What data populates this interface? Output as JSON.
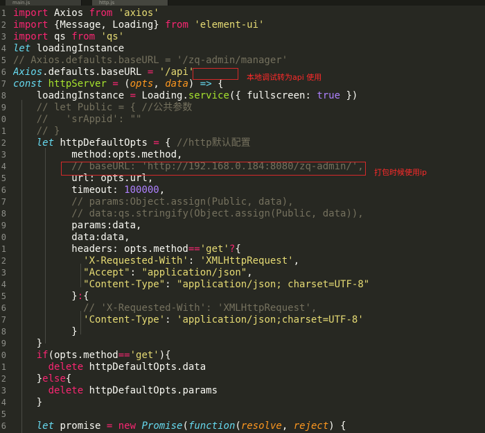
{
  "tabs": [
    "main.js",
    "http.js"
  ],
  "lines": [
    {
      "n": "1",
      "t": [
        [
          "k",
          "import"
        ],
        [
          "pl",
          " Axios "
        ],
        [
          "k",
          "from"
        ],
        [
          "pl",
          " "
        ],
        [
          "s",
          "'axios'"
        ]
      ]
    },
    {
      "n": "2",
      "t": [
        [
          "k",
          "import"
        ],
        [
          "pl",
          " {Message, Loading} "
        ],
        [
          "k",
          "from"
        ],
        [
          "pl",
          " "
        ],
        [
          "s",
          "'element-ui'"
        ]
      ]
    },
    {
      "n": "3",
      "t": [
        [
          "k",
          "import"
        ],
        [
          "pl",
          " qs "
        ],
        [
          "k",
          "from"
        ],
        [
          "pl",
          " "
        ],
        [
          "s",
          "'qs'"
        ]
      ]
    },
    {
      "n": "4",
      "t": [
        [
          "st",
          "let"
        ],
        [
          "pl",
          " loadingInstance"
        ]
      ]
    },
    {
      "n": "5",
      "t": [
        [
          "c",
          "// Axios.defaults.baseURL = '/zq-admin/manager'"
        ]
      ]
    },
    {
      "n": "6",
      "t": [
        [
          "sup",
          "Axios"
        ],
        [
          "pl",
          ".defaults.baseURL "
        ],
        [
          "o",
          "="
        ],
        [
          "pl",
          " "
        ],
        [
          "s",
          "'/api'"
        ]
      ]
    },
    {
      "n": "7",
      "t": [
        [
          "st",
          "const"
        ],
        [
          "pl",
          " "
        ],
        [
          "f",
          "httpServer"
        ],
        [
          "pl",
          " "
        ],
        [
          "o",
          "="
        ],
        [
          "pl",
          " ("
        ],
        [
          "p",
          "opts"
        ],
        [
          "pl",
          ", "
        ],
        [
          "p",
          "data"
        ],
        [
          "pl",
          ") "
        ],
        [
          "st",
          "=>"
        ],
        [
          "pl",
          " {"
        ]
      ]
    },
    {
      "n": "8",
      "t": [
        [
          "pl",
          "    loadingInstance "
        ],
        [
          "o",
          "="
        ],
        [
          "pl",
          " Loading."
        ],
        [
          "f",
          "service"
        ],
        [
          "pl",
          "({ fullscreen: "
        ],
        [
          "n",
          "true"
        ],
        [
          "pl",
          " })"
        ]
      ]
    },
    {
      "n": "9",
      "t": [
        [
          "pl",
          "    "
        ],
        [
          "c",
          "// let Public = { //公共参数"
        ]
      ]
    },
    {
      "n": "0",
      "t": [
        [
          "pl",
          "    "
        ],
        [
          "c",
          "//   'srAppid': \"\""
        ]
      ]
    },
    {
      "n": "1",
      "t": [
        [
          "pl",
          "    "
        ],
        [
          "c",
          "// }"
        ]
      ]
    },
    {
      "n": "2",
      "t": [
        [
          "pl",
          "    "
        ],
        [
          "st",
          "let"
        ],
        [
          "pl",
          " httpDefaultOpts "
        ],
        [
          "o",
          "="
        ],
        [
          "pl",
          " { "
        ],
        [
          "c",
          "//http默认配置"
        ]
      ]
    },
    {
      "n": "3",
      "t": [
        [
          "pl",
          "          method:opts.method,"
        ]
      ]
    },
    {
      "n": "4",
      "t": [
        [
          "pl",
          "          "
        ],
        [
          "c",
          "// baseURL: 'http://192.168.0.184:8080/zq-admin/',"
        ]
      ]
    },
    {
      "n": "5",
      "t": [
        [
          "pl",
          "          url: opts.url,"
        ]
      ]
    },
    {
      "n": "6",
      "t": [
        [
          "pl",
          "          timeout: "
        ],
        [
          "n",
          "100000"
        ],
        [
          "pl",
          ","
        ]
      ]
    },
    {
      "n": "7",
      "t": [
        [
          "pl",
          "          "
        ],
        [
          "c",
          "// params:Object.assign(Public, data),"
        ]
      ]
    },
    {
      "n": "8",
      "t": [
        [
          "pl",
          "          "
        ],
        [
          "c",
          "// data:qs.stringify(Object.assign(Public, data)),"
        ]
      ]
    },
    {
      "n": "9",
      "t": [
        [
          "pl",
          "          params:data,"
        ]
      ]
    },
    {
      "n": "0",
      "t": [
        [
          "pl",
          "          data:data,"
        ]
      ]
    },
    {
      "n": "1",
      "t": [
        [
          "pl",
          "          headers: opts.method"
        ],
        [
          "o",
          "=="
        ],
        [
          "s",
          "'get'"
        ],
        [
          "o",
          "?"
        ],
        [
          "pl",
          "{"
        ]
      ]
    },
    {
      "n": "2",
      "t": [
        [
          "pl",
          "            "
        ],
        [
          "s",
          "'X-Requested-With'"
        ],
        [
          "pl",
          ": "
        ],
        [
          "s",
          "'XMLHttpRequest'"
        ],
        [
          "pl",
          ","
        ]
      ]
    },
    {
      "n": "3",
      "t": [
        [
          "pl",
          "            "
        ],
        [
          "s",
          "\"Accept\""
        ],
        [
          "pl",
          ": "
        ],
        [
          "s",
          "\"application/json\""
        ],
        [
          "pl",
          ","
        ]
      ]
    },
    {
      "n": "4",
      "t": [
        [
          "pl",
          "            "
        ],
        [
          "s",
          "\"Content-Type\""
        ],
        [
          "pl",
          ": "
        ],
        [
          "s",
          "\"application/json; charset=UTF-8\""
        ]
      ]
    },
    {
      "n": "5",
      "t": [
        [
          "pl",
          "          }"
        ],
        [
          "o",
          ":"
        ],
        [
          "pl",
          "{"
        ]
      ]
    },
    {
      "n": "6",
      "t": [
        [
          "pl",
          "            "
        ],
        [
          "c",
          "// 'X-Requested-With': 'XMLHttpRequest',"
        ]
      ]
    },
    {
      "n": "7",
      "t": [
        [
          "pl",
          "            "
        ],
        [
          "s",
          "'Content-Type'"
        ],
        [
          "pl",
          ": "
        ],
        [
          "s",
          "'application/json;charset=UTF-8'"
        ]
      ]
    },
    {
      "n": "8",
      "t": [
        [
          "pl",
          "          }"
        ]
      ]
    },
    {
      "n": "9",
      "t": [
        [
          "pl",
          "    }"
        ]
      ]
    },
    {
      "n": "0",
      "t": [
        [
          "pl",
          "    "
        ],
        [
          "k",
          "if"
        ],
        [
          "pl",
          "(opts.method"
        ],
        [
          "o",
          "=="
        ],
        [
          "s",
          "'get'"
        ],
        [
          "pl",
          "){"
        ]
      ]
    },
    {
      "n": "1",
      "t": [
        [
          "pl",
          "      "
        ],
        [
          "k",
          "delete"
        ],
        [
          "pl",
          " httpDefaultOpts.data"
        ]
      ]
    },
    {
      "n": "2",
      "t": [
        [
          "pl",
          "    }"
        ],
        [
          "k",
          "else"
        ],
        [
          "pl",
          "{"
        ]
      ]
    },
    {
      "n": "3",
      "t": [
        [
          "pl",
          "      "
        ],
        [
          "k",
          "delete"
        ],
        [
          "pl",
          " httpDefaultOpts.params"
        ]
      ]
    },
    {
      "n": "4",
      "t": [
        [
          "pl",
          "    }"
        ]
      ]
    },
    {
      "n": "5",
      "t": [
        [
          "pl",
          ""
        ]
      ]
    },
    {
      "n": "6",
      "t": [
        [
          "pl",
          "    "
        ],
        [
          "st",
          "let"
        ],
        [
          "pl",
          " promise "
        ],
        [
          "o",
          "="
        ],
        [
          "pl",
          " "
        ],
        [
          "k",
          "new"
        ],
        [
          "pl",
          " "
        ],
        [
          "sup",
          "Promise"
        ],
        [
          "pl",
          "("
        ],
        [
          "st",
          "function"
        ],
        [
          "pl",
          "("
        ],
        [
          "p",
          "resolve"
        ],
        [
          "pl",
          ", "
        ],
        [
          "p",
          "reject"
        ],
        [
          "pl",
          ") {"
        ]
      ]
    }
  ],
  "annotations": {
    "local_api": "本地调试转为api 使用",
    "package_ip": "打包时候使用ip"
  },
  "colors": {
    "background": "#272822",
    "annotation": "#ff2a2a",
    "keyword": "#f92672",
    "string": "#e6db74",
    "comment": "#75715e"
  }
}
